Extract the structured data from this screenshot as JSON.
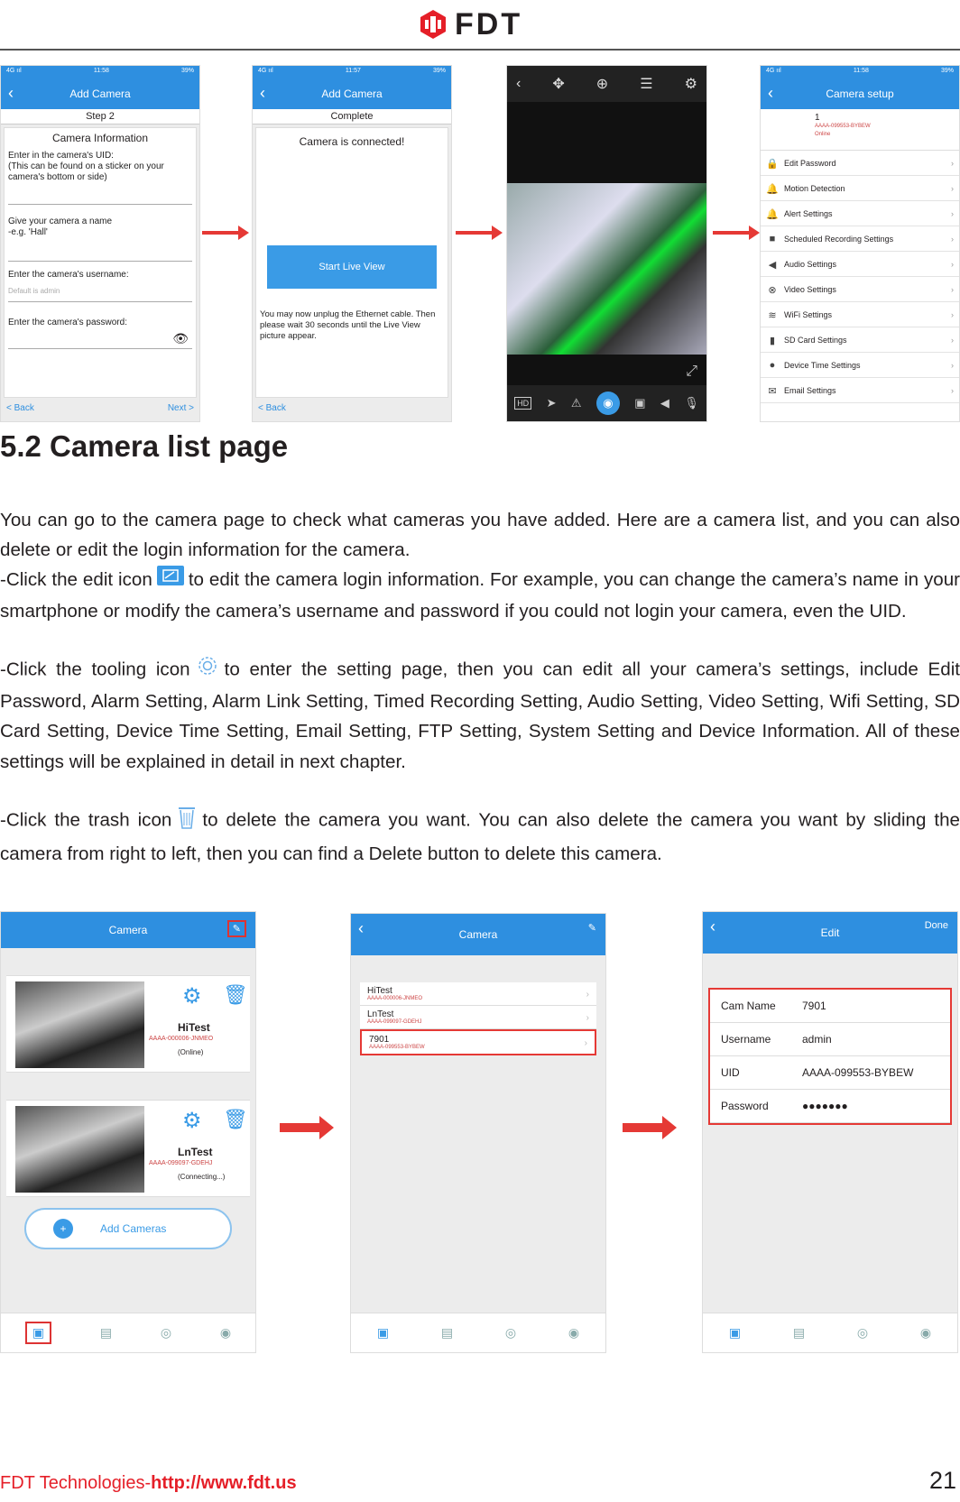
{
  "header": {
    "logo_text": "FDT",
    "brand_color": "#e51f28"
  },
  "top_screens": {
    "screen1": {
      "status_time": "11:58",
      "title": "Add Camera",
      "step": "Step 2",
      "section": "Camera Information",
      "uid_label": "Enter in the camera's UID:\n(This can be found on a sticker on your camera's bottom or side)",
      "name_label": "Give your camera a name\n      -e.g. 'Hall'",
      "username_label": "Enter the camera's username:",
      "username_value": "Default is admin",
      "password_label": "Enter the camera's password:",
      "back": "< Back",
      "next": "Next >"
    },
    "screen2": {
      "status_time": "11:57",
      "title": "Add Camera",
      "step": "Complete",
      "message": "Camera is connected!",
      "button": "Start Live View",
      "note": "You may now unplug the Ethernet cable. Then please wait 30 seconds until the Live View picture appear.",
      "back": "< Back"
    },
    "screen3": {
      "hd_label": "HD"
    },
    "screen4": {
      "status_time": "11:58",
      "title": "Camera setup",
      "cam_number": "1",
      "items": [
        {
          "icon": "lock-icon",
          "glyph": "🔒",
          "label": "Edit Password"
        },
        {
          "icon": "motion-icon",
          "glyph": "🔔",
          "label": "Motion Detection"
        },
        {
          "icon": "alert-icon",
          "glyph": "🔔",
          "label": "Alert Settings"
        },
        {
          "icon": "record-icon",
          "glyph": "■",
          "label": "Scheduled Recording Settings"
        },
        {
          "icon": "audio-icon",
          "glyph": "◀",
          "label": "Audio Settings"
        },
        {
          "icon": "video-icon",
          "glyph": "⊗",
          "label": "Video Settings"
        },
        {
          "icon": "wifi-icon",
          "glyph": "≋",
          "label": "WiFi Settings"
        },
        {
          "icon": "sdcard-icon",
          "glyph": "▮",
          "label": "SD Card Settings"
        },
        {
          "icon": "clock-icon",
          "glyph": "●",
          "label": "Device Time Settings"
        },
        {
          "icon": "mail-icon",
          "glyph": "✉",
          "label": "Email Settings"
        }
      ]
    }
  },
  "content": {
    "heading": "5.2 Camera list page",
    "p1": "You can go to the camera page to check what cameras you have added. Here are a camera list, and you can also delete or edit the login information for the camera.",
    "p2_before": "-Click the edit icon",
    "p2_after": "to edit the camera login information. For example, you can change the camera’s name in your smartphone or modify the camera’s username and password if you could not login your camera, even the UID.",
    "p3_before": "-Click the tooling icon",
    "p3_after": "to enter the setting page, then you can edit all your camera’s settings, include Edit Password, Alarm Setting, Alarm Link Setting, Timed Recording Setting, Audio Setting, Video Setting, Wifi Setting, SD Card Setting, Device Time Setting, Email Setting, FTP Setting, System Setting and Device Information. All of these settings will be explained in detail in next chapter.",
    "p4_before": "-Click the trash icon",
    "p4_after": "to delete the camera you want. You can also delete the camera you want by sliding the camera from right to left, then you can find a Delete button to delete this camera."
  },
  "bottom_screens": {
    "list_screen": {
      "title": "Camera",
      "cams": [
        {
          "name": "HiTest",
          "uid": "AAAA-000006-JNMEO",
          "status": "(Online)"
        },
        {
          "name": "LnTest",
          "uid": "AAAA-099097-GDEHJ",
          "status": "(Connecting...)"
        }
      ],
      "add_button": "Add Cameras"
    },
    "compact_screen": {
      "title": "Camera",
      "cams": [
        {
          "name": "HiTest",
          "uid": "AAAA-000006-JNMEO"
        },
        {
          "name": "LnTest",
          "uid": "AAAA-099097-GDEHJ"
        },
        {
          "name": "7901",
          "uid": "AAAA-099553-BYBEW"
        }
      ]
    },
    "edit_screen": {
      "title": "Edit",
      "done": "Done",
      "fields": [
        {
          "key": "Cam Name",
          "value": "7901"
        },
        {
          "key": "Username",
          "value": "admin"
        },
        {
          "key": "UID",
          "value": "AAAA-099553-BYBEW"
        },
        {
          "key": "Password",
          "value": "●●●●●●●"
        }
      ]
    }
  },
  "footer": {
    "company": "FDT Technologies-",
    "url": "http://www.fdt.us",
    "page_number": "21"
  }
}
